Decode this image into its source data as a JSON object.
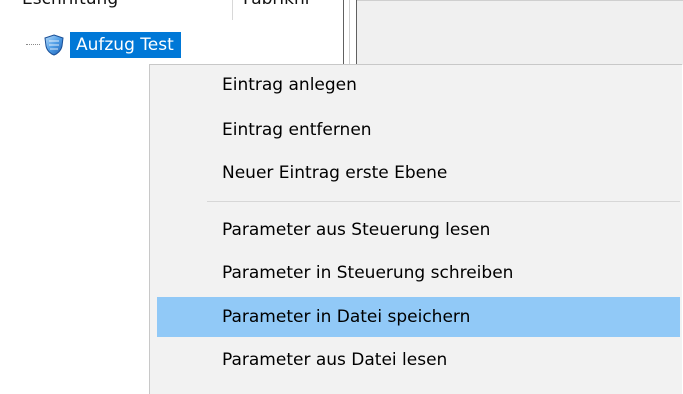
{
  "tree": {
    "columns": [
      "Eschriftung",
      "Fabriknr"
    ],
    "selected_item": "Aufzug Test",
    "icon": "shield-icon"
  },
  "context_menu": {
    "items": [
      {
        "label": "Eintrag anlegen"
      },
      {
        "label": "Eintrag entfernen"
      },
      {
        "label": "Neuer Eintrag erste Ebene"
      },
      {
        "label": "Parameter aus Steuerung lesen"
      },
      {
        "label": "Parameter in Steuerung schreiben"
      },
      {
        "label": "Parameter in  Datei speichern",
        "highlighted": true
      },
      {
        "label": "Parameter aus Datei lesen"
      }
    ]
  },
  "colors": {
    "selection": "#0078d7",
    "menu_background": "#f2f2f2",
    "menu_highlight": "#91c9f7"
  }
}
